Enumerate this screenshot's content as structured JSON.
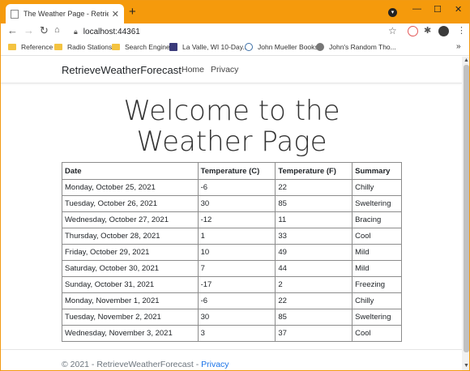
{
  "browser": {
    "tab_title": "The Weather Page - RetrieveWea",
    "tab_close": "✕",
    "new_tab": "+",
    "address": "localhost:44361",
    "window_controls": [
      "—",
      "☐",
      "✕"
    ],
    "accent_color": "#f59a0c"
  },
  "bookmarks": [
    {
      "label": "Reference",
      "icon": "folder-icon"
    },
    {
      "label": "Radio Stations",
      "icon": "folder-icon"
    },
    {
      "label": "Search Engines",
      "icon": "folder-icon"
    },
    {
      "label": "La Valle, WI 10-Day...",
      "icon": "weather-site-icon"
    },
    {
      "label": "John Mueller Books",
      "icon": "wordpress-icon"
    },
    {
      "label": "John's Random Tho...",
      "icon": "globe-icon"
    }
  ],
  "bookmarks_more": "»",
  "site": {
    "brand": "RetrieveWeatherForecast",
    "nav": [
      "Home",
      "Privacy"
    ]
  },
  "page": {
    "heading": "Welcome to the Weather Page"
  },
  "table": {
    "headers": [
      "Date",
      "Temperature (C)",
      "Temperature (F)",
      "Summary"
    ],
    "rows": [
      [
        "Monday, October 25, 2021",
        "-6",
        "22",
        "Chilly"
      ],
      [
        "Tuesday, October 26, 2021",
        "30",
        "85",
        "Sweltering"
      ],
      [
        "Wednesday, October 27, 2021",
        "-12",
        "11",
        "Bracing"
      ],
      [
        "Thursday, October 28, 2021",
        "1",
        "33",
        "Cool"
      ],
      [
        "Friday, October 29, 2021",
        "10",
        "49",
        "Mild"
      ],
      [
        "Saturday, October 30, 2021",
        "7",
        "44",
        "Mild"
      ],
      [
        "Sunday, October 31, 2021",
        "-17",
        "2",
        "Freezing"
      ],
      [
        "Monday, November 1, 2021",
        "-6",
        "22",
        "Chilly"
      ],
      [
        "Tuesday, November 2, 2021",
        "30",
        "85",
        "Sweltering"
      ],
      [
        "Wednesday, November 3, 2021",
        "3",
        "37",
        "Cool"
      ]
    ]
  },
  "footer": {
    "text": "© 2021 - RetrieveWeatherForecast - ",
    "link": "Privacy"
  }
}
